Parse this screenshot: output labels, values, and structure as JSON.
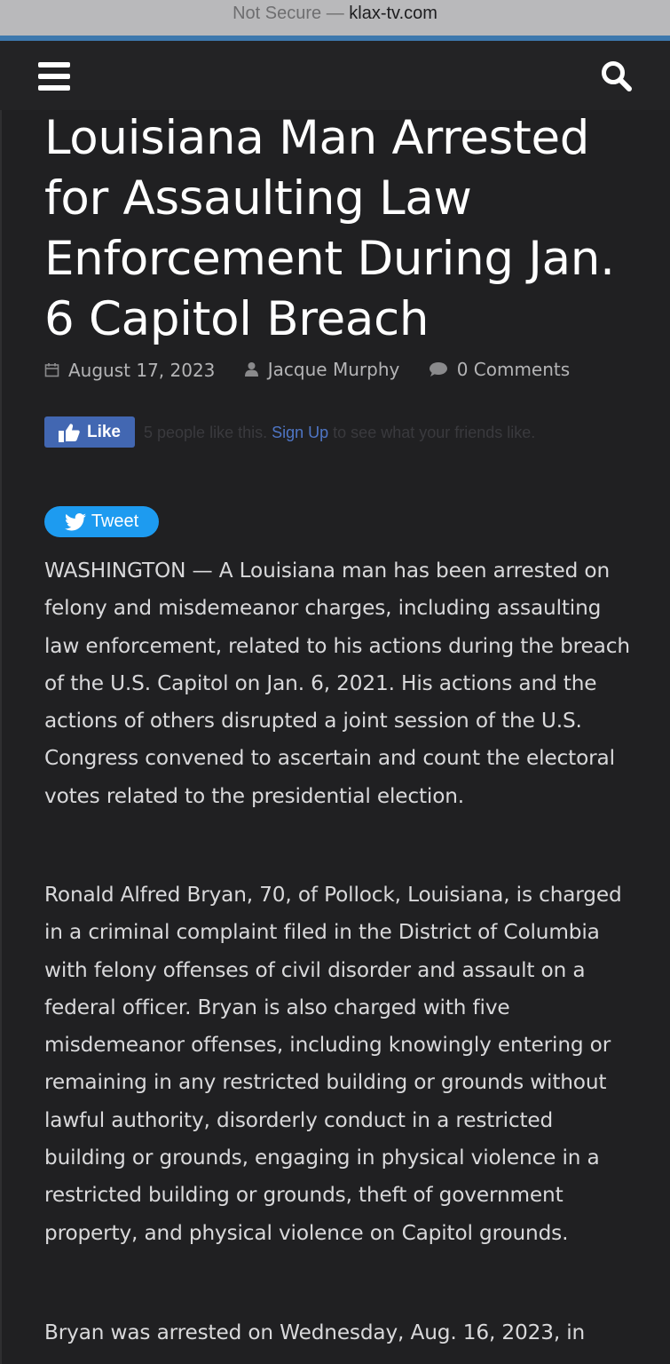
{
  "browser": {
    "security_label": "Not Secure —",
    "domain": "klax-tv.com"
  },
  "nav": {
    "menu_icon": "hamburger-menu-icon",
    "search_icon": "search-icon"
  },
  "article": {
    "title": "Louisiana Man Arrested for Assaulting Law Enforcement During Jan. 6 Capitol Breach",
    "date": "August 17, 2023",
    "author": "Jacque Murphy",
    "comments": "0 Comments",
    "paragraphs": [
      "WASHINGTON — A Louisiana man has been arrested on felony and misdemeanor charges, including assaulting law enforcement, related to his actions during the breach of the U.S. Capitol on Jan. 6, 2021. His actions and the actions of others disrupted a joint session of the U.S. Congress convened to ascertain and count the electoral votes related to the presidential election.",
      "Ronald Alfred Bryan, 70, of Pollock, Louisiana, is charged in a criminal complaint filed in the District of Columbia with felony offenses of civil disorder and assault on a federal officer. Bryan is also charged with five misdemeanor offenses, including knowingly entering or remaining in any restricted building or grounds without lawful authority, disorderly conduct in a restricted building or grounds, engaging in physical violence in a restricted building or grounds, theft of government property, and physical violence on Capitol grounds.",
      "Bryan was arrested on Wednesday, Aug. 16, 2023, in"
    ]
  },
  "social": {
    "like_label": "Like",
    "like_text_before": "5 people like this.",
    "signup_label": "Sign Up",
    "like_text_after": "to see what your friends like.",
    "tweet_label": "Tweet"
  },
  "colors": {
    "background": "#1f1f21",
    "accent": "#3d78ad",
    "facebook": "#4267b2",
    "twitter": "#1d9bf0"
  }
}
